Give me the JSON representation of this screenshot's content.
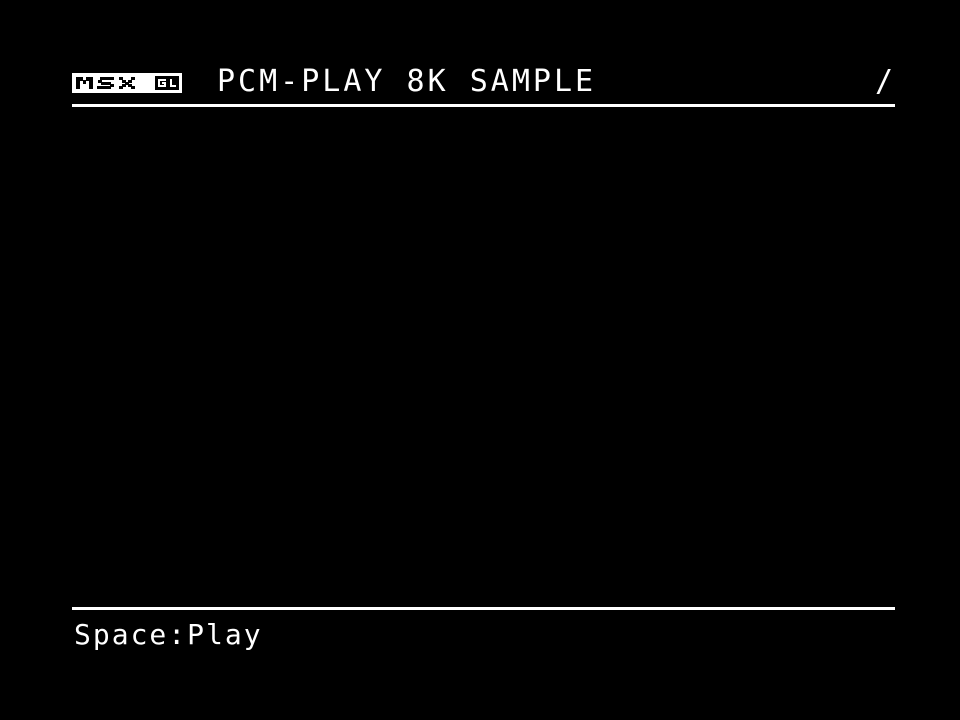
{
  "header": {
    "logo_text": "MSXgl",
    "title": "PCM-PLAY 8K SAMPLE",
    "activity_indicator": "/"
  },
  "footer": {
    "hint": "Space:Play"
  },
  "colors": {
    "background": "#000000",
    "foreground": "#ffffff"
  }
}
